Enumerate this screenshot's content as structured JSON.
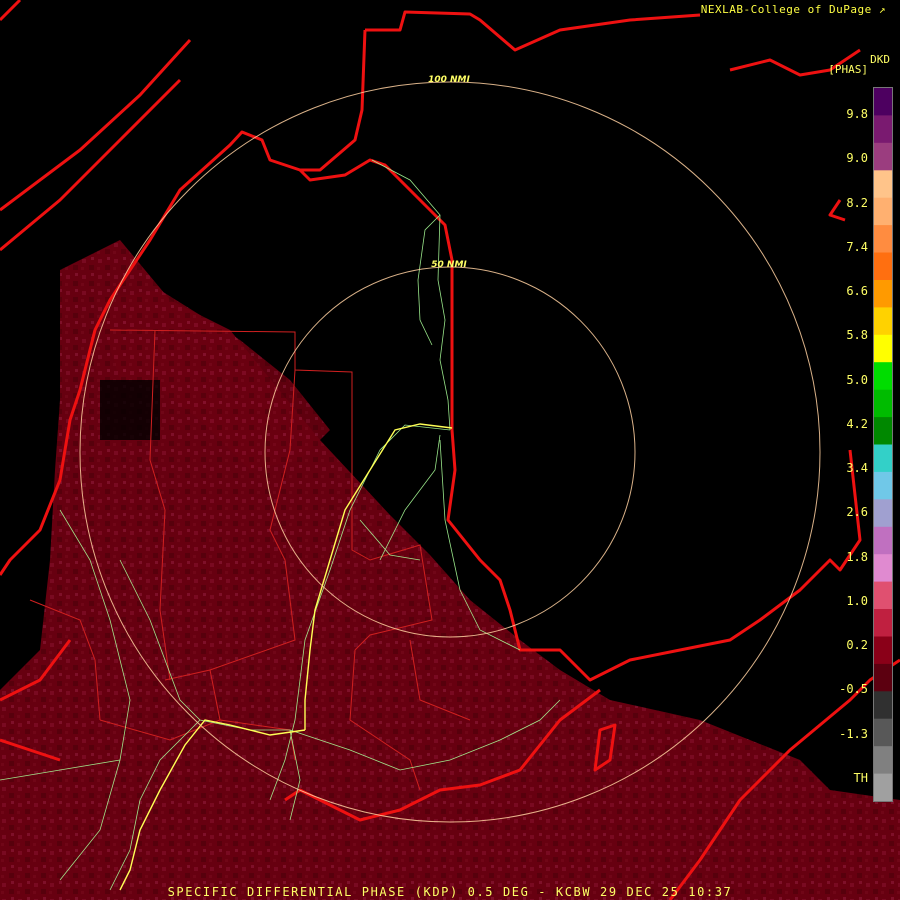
{
  "header": {
    "credit": "NEXLAB-College of DuPage",
    "product_code": "DKD",
    "product_unit": "[PHAS]"
  },
  "rings": {
    "outer_label": "100 NMI",
    "inner_label": "50 NMI"
  },
  "legend": {
    "ticks": [
      "9.8",
      "9.0",
      "8.2",
      "7.4",
      "6.6",
      "5.8",
      "5.0",
      "4.2",
      "3.4",
      "2.6",
      "1.8",
      "1.0",
      "0.2",
      "-0.5",
      "-1.3",
      "TH"
    ],
    "colors": [
      "#4d0060",
      "#7a1a70",
      "#9b3d7f",
      "#ffc48a",
      "#ffb070",
      "#ff8c40",
      "#ff6f10",
      "#ff9a00",
      "#ffd200",
      "#ffff00",
      "#00dd00",
      "#00bb00",
      "#008800",
      "#33d0c8",
      "#70c8e8",
      "#a0a0d0",
      "#c070c0",
      "#e08ad0",
      "#e05070",
      "#c02040",
      "#8a0018",
      "#5c0010",
      "#303030",
      "#585858",
      "#808080",
      "#a0a0a0"
    ]
  },
  "footer": {
    "caption": "SPECIFIC DIFFERENTIAL PHASE (KDP) 0.5 DEG - KCBW 29 DEC 25 10:37"
  }
}
